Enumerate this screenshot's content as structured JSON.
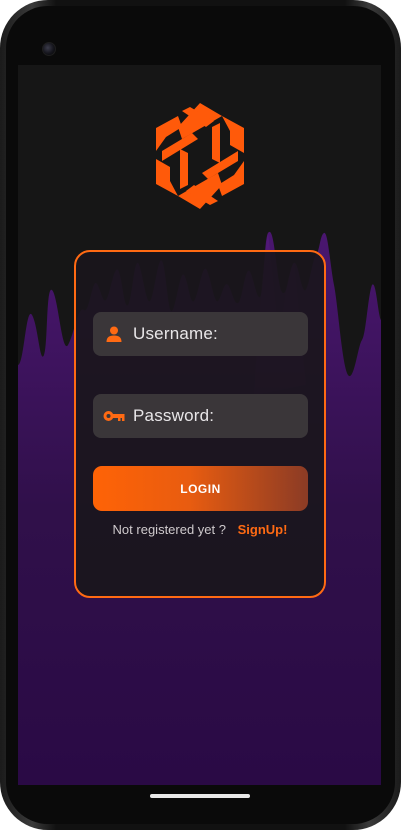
{
  "form": {
    "username_label": "Username:",
    "password_label": "Password:",
    "login_label": "LOGIN",
    "signup_prompt": "Not registered yet ?",
    "signup_link": "SignUp!"
  },
  "icons": {
    "logo": "hexagon-spiral-logo",
    "username": "person-icon",
    "password": "key-icon"
  },
  "colors": {
    "accent": "#ff6a13",
    "background": "#161616",
    "wave": "#3a1057",
    "field": "#3a3639",
    "card_border": "#ff6a13"
  }
}
